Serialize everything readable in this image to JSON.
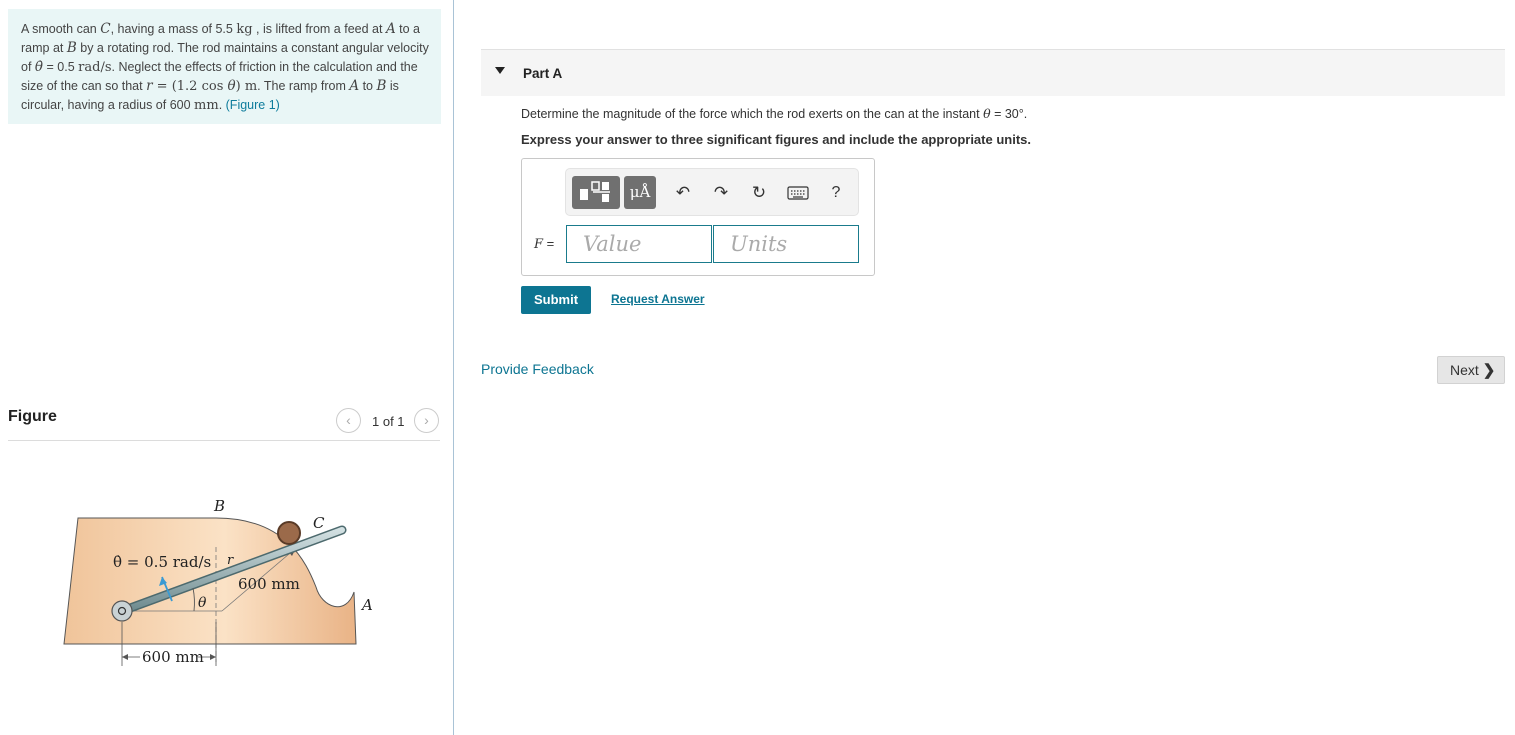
{
  "problem": {
    "s1": "A smooth can ",
    "s2": "C",
    "s3": ", having a mass of 5.5 ",
    "s4": "kg",
    "s5": " , is lifted from a feed at ",
    "s6": "A",
    "s7": " to a ramp at ",
    "s8": "B",
    "s9": " by a rotating rod. The rod maintains a constant angular velocity of ",
    "s10": "θ̇",
    "s11": " = 0.5 ",
    "s12": "rad/s",
    "s13": ". Neglect the effects of friction in the calculation and the size of the can so that ",
    "s14": "r",
    "s15": " = (1.2 cos ",
    "s16": "θ",
    "s17": ") m",
    "s18": ". The ramp from ",
    "s19": "A",
    "s20": " to ",
    "s21": "B",
    "s22": " is circular, having a radius of 600 ",
    "s23": "mm",
    "s24": ". ",
    "figure_link": "(Figure 1)"
  },
  "figure_panel": {
    "title": "Figure",
    "prev_icon": "‹",
    "next_icon": "›",
    "count": "1 of 1",
    "labels": {
      "B": "B",
      "C": "C",
      "A": "A",
      "r": "r",
      "theta": "θ",
      "omega": "θ̇ = 0.5 rad/s",
      "radius": "600 mm",
      "dim": "600 mm"
    }
  },
  "part": {
    "title": "Part A",
    "question_pre": "Determine the magnitude of the force which the rod exerts on the can at the instant ",
    "question_sym": "θ",
    "question_post": " = 30°.",
    "instruction": "Express your answer to three significant figures and include the appropriate units."
  },
  "toolbar": {
    "units_label": "μÅ",
    "undo": "↶",
    "redo": "↷",
    "reset": "↻",
    "help": "?"
  },
  "answer": {
    "label_sym": "F",
    "label_eq": " =",
    "value_placeholder": "Value",
    "units_placeholder": "Units"
  },
  "actions": {
    "submit": "Submit",
    "request": "Request Answer",
    "feedback": "Provide Feedback",
    "next": "Next",
    "next_chevron": "❯"
  }
}
